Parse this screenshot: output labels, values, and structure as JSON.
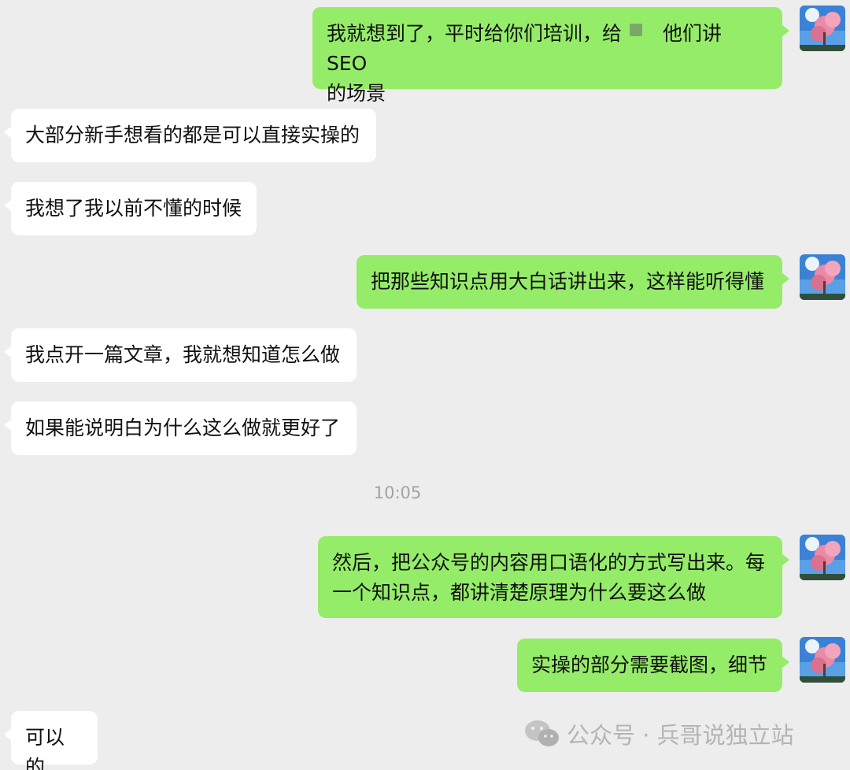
{
  "messages": [
    {
      "side": "me",
      "text_part1": "我就想到了，平时给你们培训，给",
      "text_part2": "他们讲 SEO",
      "text_line2": "的场景"
    },
    {
      "side": "other",
      "text": "大部分新手想看的都是可以直接实操的"
    },
    {
      "side": "other",
      "text": "我想了我以前不懂的时候"
    },
    {
      "side": "me",
      "text": "把那些知识点用大白话讲出来，这样能听得懂"
    },
    {
      "side": "other",
      "text": "我点开一篇文章，我就想知道怎么做"
    },
    {
      "side": "other",
      "text": "如果能说明白为什么这么做就更好了"
    },
    {
      "side": "me",
      "text": "然后，把公众号的内容用口语化的方式写出来。每\n一个知识点，都讲清楚原理为什么要这么做"
    },
    {
      "side": "me",
      "text": "实操的部分需要截图，细节"
    },
    {
      "side": "other",
      "text": "可以的"
    }
  ],
  "timestamp": "10:05",
  "watermark": {
    "text": "公众号 · 兵哥说独立站",
    "icon": "wechat-icon"
  },
  "avatar": {
    "icon": "cherry-blossom-avatar"
  },
  "colors": {
    "background": "#ededed",
    "my_bubble": "#95ec69",
    "their_bubble": "#ffffff",
    "timestamp": "#a3a3a3"
  }
}
